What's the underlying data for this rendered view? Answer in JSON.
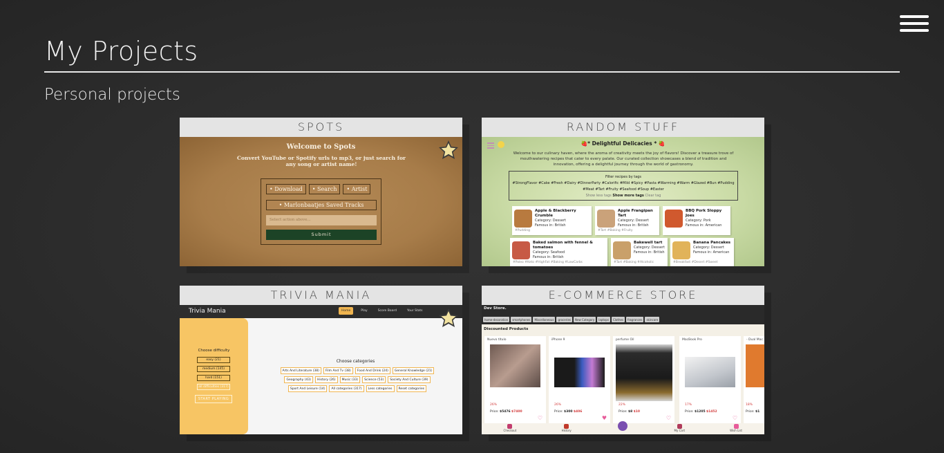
{
  "header": {
    "title": "My Projects",
    "menu_icon": "hamburger-menu-icon"
  },
  "section": {
    "title": "Personal projects"
  },
  "cards": {
    "spots": {
      "label": "SPOTS",
      "starred": true,
      "preview": {
        "title": "Welcome to Spots",
        "subtitle": "Convert YouTube or Spotify urls to mp3, or just search for any song or artist name!",
        "buttons": [
          "• Download",
          "• Search",
          "• Artist"
        ],
        "saved_tracks": "• Marlonbaatjes Saved Tracks",
        "input_placeholder": "Select action above...",
        "submit": "Submit"
      }
    },
    "random": {
      "label": "RANDOM STUFF",
      "preview": {
        "title": "Delightful Delicacies",
        "title_left_emoji": "🍓*",
        "title_right_emoji": "* 🍓",
        "description": "Welcome to our culinary haven, where the aroma of creativity meets the joy of flavors! Discover a treasure trove of mouthwatering recipes that cater to every palate. Our curated collection showcases a blend of tradition and innovation, offering a delightful journey through the world of gastronomy.",
        "filter_title": "Filter recipes by tags",
        "tags_line1": "#StrongFlavor #Cake #Fresh #Dairy #DinnerParty #Calorific #Mild #Spicy #Pasta #Warming #Warm #Glazed #Bun #Pudding",
        "tags_line2": "#Meat #Tart #Fruity #Seafood #Soup #Easter",
        "show_less": "Show less tags",
        "show_more": "Show more tags",
        "clear": "Clear tag",
        "recipes": [
          {
            "name": "Apple & Blackberry Crumble",
            "category": "Category: Dessert",
            "famous": "Famous in: British",
            "tags": "#Pudding",
            "color": "#b87a3f"
          },
          {
            "name": "Apple Frangipan Tart",
            "category": "Category: Dessert",
            "famous": "Famous in: British",
            "tags": "#Tart #Baking #Fruity",
            "color": "#caa27a"
          },
          {
            "name": "BBQ Pork Sloppy Joes",
            "category": "Category: Pork",
            "famous": "Famous in: American",
            "tags": "",
            "color": "#d0592e"
          },
          {
            "name": "Baked salmon with fennel & tomatoes",
            "category": "Category: Seafood",
            "famous": "Famous in: British",
            "tags": "#Paleo #Keto #HighFat #Baking #LowCarbs",
            "color": "#c75a45"
          },
          {
            "name": "Bakewell tart",
            "category": "Category: Dessert",
            "famous": "Famous in: British",
            "tags": "#Tart #Baking #Alcoholic",
            "color": "#c9a06a"
          },
          {
            "name": "Banana Pancakes",
            "category": "Category: Dessert",
            "famous": "Famous in: American",
            "tags": "#Breakfast #Desert #Sweet",
            "color": "#e1b35a"
          }
        ]
      }
    },
    "trivia": {
      "label": "TRIVIA MANIA",
      "starred": true,
      "preview": {
        "brand": "Trivia Mania",
        "nav": [
          "Home",
          "Play",
          "Score Board",
          "Your Stats"
        ],
        "choose_difficulty": "Choose difficulty",
        "difficulties": [
          "easy (21)",
          "medium (145)",
          "hard (151)",
          "all difficulties (317)"
        ],
        "start": "START PLAYING",
        "choose_categories": "Choose categories",
        "categories": [
          "Arts And Literature (38)",
          "Film And Tv (38)",
          "Food And Drink (24)",
          "General Knowledge (21)",
          "Geography (43)",
          "History (26)",
          "Music (33)",
          "Science (53)",
          "Society And Culture (39)",
          "Sport And Leisure (14)",
          "All categories (317)",
          "Less categories",
          "Reset categories"
        ]
      }
    },
    "ecommerce": {
      "label": "E-COMMERCE STORE",
      "preview": {
        "brand": "Dev Store.",
        "categories": [
          "home-decoration",
          "smartphones",
          "Miscellaneous",
          "groceries",
          "New Category",
          "laptops",
          "Clothes",
          "fragrances",
          "skincare"
        ],
        "section": "Discounted Products",
        "products": [
          {
            "name": "Nuevo título",
            "discount": "26%",
            "price_label": "Price:",
            "price": "$5476",
            "old_price": "$7400",
            "color": "#8a6d62"
          },
          {
            "name": "iPhone 9",
            "discount": "26%",
            "price_label": "Price:",
            "price": "$300",
            "old_price": "$406",
            "color": "#1b1b1b"
          },
          {
            "name": "perfume Oil",
            "discount": "22%",
            "price_label": "Price:",
            "price": "$8",
            "old_price": "$10",
            "color": "#3a3a3a"
          },
          {
            "name": "MacBook Pro",
            "discount": "17%",
            "price_label": "Price:",
            "price": "$1205",
            "old_price": "$1452",
            "color": "#cfd2d6"
          },
          {
            "name": "- Dual Mac",
            "discount": "18%",
            "price_label": "Price:",
            "price": "$1",
            "old_price": "",
            "color": "#e07a2e"
          }
        ],
        "bottom_nav": [
          "Checkout",
          "History",
          "",
          "My Cart",
          "Wish List"
        ]
      }
    }
  },
  "colors": {
    "background": "#2f2f2f",
    "card_header": "#e4e4e4",
    "star": "#f3e3a0"
  }
}
